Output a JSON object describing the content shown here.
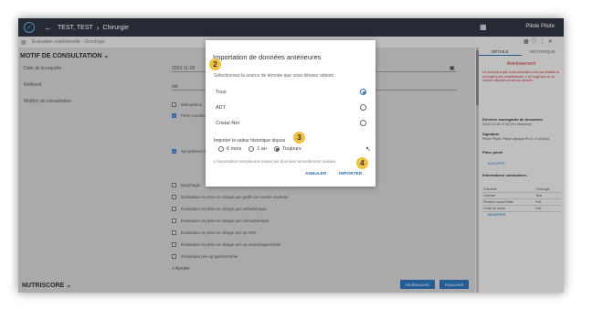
{
  "topbar": {
    "back_icon": "arrow-left-icon",
    "patient": "TEST, TEST",
    "service": "Chirurgie",
    "user": "Pilote Pilote"
  },
  "subbar": {
    "document": "Évaluation nutritionnelle - Oncologie"
  },
  "form": {
    "section_title": "MOTIF DE CONSULTATION",
    "date_label": "Date de la requête",
    "date_value": "2022-11-28",
    "referent_label": "Référent",
    "referent_value": "mb",
    "motif_label": "Motif(s) de consultation",
    "checkboxes_top": [
      {
        "label": "Malnutrition",
        "checked": false
      },
      {
        "label": "Perte pondérale",
        "checked": true
      },
      {
        "label": "Symptômes lié",
        "checked": true
      }
    ],
    "checkboxes": [
      {
        "label": "Dysphagie",
        "checked": false
      },
      {
        "label": "Évaluation et prise en charge par greffe de moelle osseuse",
        "checked": false
      },
      {
        "label": "Évaluation et prise en charge par radiothérapie",
        "checked": false
      },
      {
        "label": "Évaluation et prise en charge par chimiothérapie",
        "checked": false
      },
      {
        "label": "Évaluation et prise en charge pré-op ORL",
        "checked": false
      },
      {
        "label": "Évaluation et prise en charge pré-op oesophagectomie",
        "checked": false
      },
      {
        "label": "Évaluation pré-op gastrectomie",
        "checked": false
      }
    ],
    "add_label": "+ Ajouter",
    "nutriscore_title": "NUTRISCORE",
    "btn_draft": "EN ÉBAUCHE",
    "btn_finalize": "FINALISER"
  },
  "right_panel": {
    "tabs": [
      "DÉTAILS",
      "HISTORIQUE"
    ],
    "warning_title": "Avertissement",
    "warning_text": "Le document que vous consultez n'est pas finalisé et est sujet à des modifications. Il se s'agit pas de la version officielle versée au dossier.",
    "saved_label": "Dernière sauvegarde du document",
    "saved_value": "2023-02-08 07:52 (En ébauche)",
    "signature_label": "Signature",
    "signature_value": "Pilote Pilote, Pilote clinique Ph.D, # 144444",
    "attachment_label": "Pièce jointe",
    "attachment_link": "AJOUTER",
    "nominal_label": "Informations nominatives",
    "nominal_rows": [
      [
        "Clientèle",
        "Chirurgie"
      ],
      [
        "Guichet",
        "Test"
      ],
      [
        "Rendez-vous/Visite",
        "N/A"
      ],
      [
        "Unité de soins",
        "N/A"
      ]
    ],
    "modify_link": "MODIFIER"
  },
  "dialog": {
    "title": "Importation de données antérieures",
    "subtitle": "Sélectionnez la source de donnée que vous désirez obtenir.",
    "sources": [
      {
        "label": "Tous",
        "selected": true
      },
      {
        "label": "ADT",
        "selected": false
      },
      {
        "label": "Cristal-Net",
        "selected": false
      }
    ],
    "history_label": "Importer la valeur historique depuis",
    "history_options": [
      {
        "label": "6 mois",
        "selected": false
      },
      {
        "label": "1 an",
        "selected": false
      },
      {
        "label": "Toujours",
        "selected": true
      }
    ],
    "note": "L'importation remplacera toutes les données actuellement saisies.",
    "cancel": "ANNULER",
    "import": "IMPORTER"
  },
  "badges": [
    "2",
    "3",
    "4"
  ],
  "colors": {
    "topbar": "#2f3440",
    "accent": "#2d72b8",
    "warning": "#c53030",
    "badge": "#f0c040"
  }
}
